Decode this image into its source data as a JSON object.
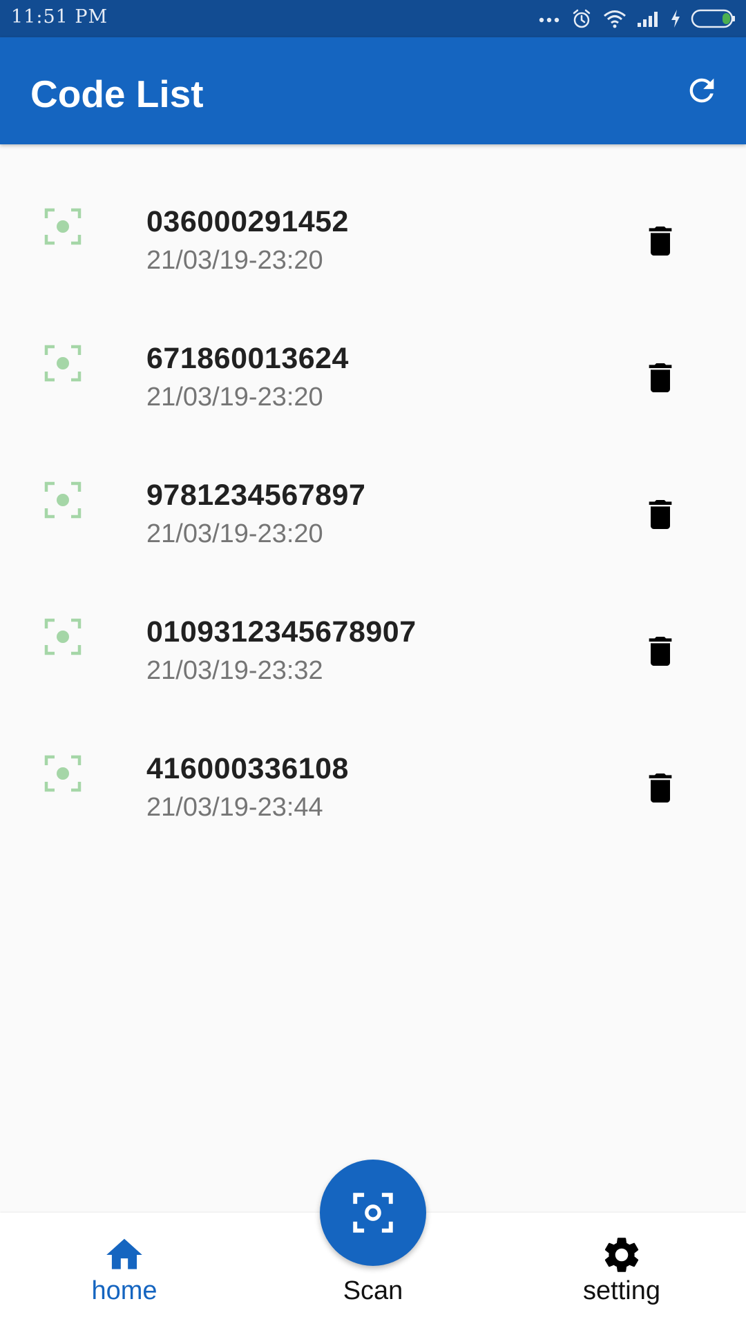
{
  "status_bar": {
    "time": "11:51 PM",
    "icons": [
      "more-dots-icon",
      "alarm-icon",
      "wifi-icon",
      "signal-icon",
      "charging-icon",
      "battery-icon"
    ]
  },
  "app_bar": {
    "title": "Code List",
    "action_icon": "refresh-icon"
  },
  "codes": [
    {
      "code": "036000291452",
      "datetime": "21/03/19-23:20"
    },
    {
      "code": "671860013624",
      "datetime": "21/03/19-23:20"
    },
    {
      "code": "9781234567897",
      "datetime": "21/03/19-23:20"
    },
    {
      "code": "0109312345678907",
      "datetime": "21/03/19-23:32"
    },
    {
      "code": "416000336108",
      "datetime": "21/03/19-23:44"
    }
  ],
  "bottom_nav": {
    "items": [
      {
        "label": "home",
        "icon": "home-icon",
        "active": true
      },
      {
        "label": "Scan",
        "icon": "scan-icon",
        "active": false
      },
      {
        "label": "setting",
        "icon": "gear-icon",
        "active": false
      }
    ]
  },
  "colors": {
    "primary": "#1565c0",
    "status_bar": "#124c92",
    "scan_icon_green": "#a5d6a7",
    "background": "#fafafa"
  }
}
